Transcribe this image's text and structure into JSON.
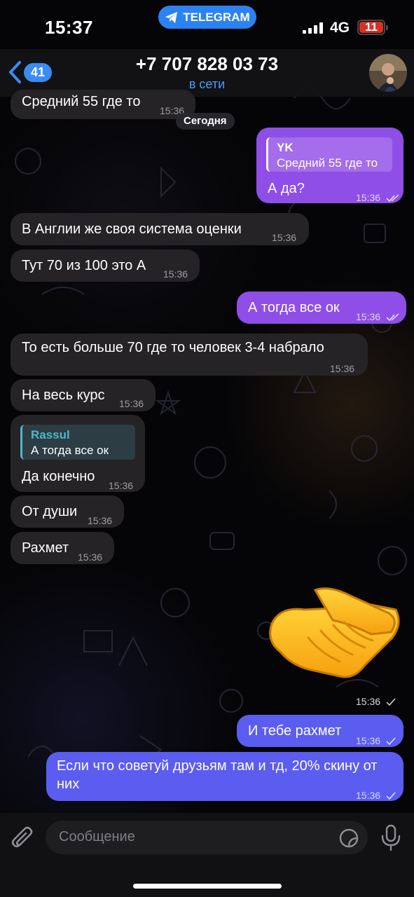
{
  "status_bar": {
    "time": "15:37",
    "app_pill": "TELEGRAM",
    "network": "4G",
    "battery": "11"
  },
  "header": {
    "back_count": "41",
    "title": "+7 707 828 03 73",
    "subtitle": "в сети"
  },
  "date_separator": "Сегодня",
  "messages": [
    {
      "dir": "in",
      "text": "Средний 55 где то",
      "time": "15:36"
    },
    {
      "dir": "out",
      "reply_name": "YK",
      "reply_text": "Средний 55 где то",
      "text": "А да?",
      "time": "15:36"
    },
    {
      "dir": "in",
      "text": "В Англии же своя система оценки",
      "time": "15:36"
    },
    {
      "dir": "in",
      "text": "Тут 70 из 100 это А",
      "time": "15:36"
    },
    {
      "dir": "out",
      "text": "А тогда все ок",
      "time": "15:36"
    },
    {
      "dir": "in",
      "text": "То есть больше 70 где то человек 3-4 набрало",
      "time": "15:36"
    },
    {
      "dir": "in",
      "text": "На весь курс",
      "time": "15:36"
    },
    {
      "dir": "in",
      "reply_name": "Rassul",
      "reply_text": "А тогда все ок",
      "text": "Да конечно",
      "time": "15:36"
    },
    {
      "dir": "in",
      "text": "От души",
      "time": "15:36"
    },
    {
      "dir": "in",
      "text": "Рахмет",
      "time": "15:36"
    },
    {
      "dir": "out",
      "sticker": "handshake-emoji",
      "time": "15:36"
    },
    {
      "dir": "out",
      "text": "И тебе рахмет",
      "time": "15:36"
    },
    {
      "dir": "out",
      "text": "Если что советуй друзьям там и тд, 20% скину от них",
      "time": "15:36"
    }
  ],
  "composer": {
    "placeholder": "Сообщение"
  },
  "colors": {
    "outgoing_purple": "#8f4ee7",
    "outgoing_blue": "#5b5cf0",
    "incoming": "#252326",
    "accent": "#3a8cf3",
    "reply_accent_in": "#4fb6c8"
  },
  "icons": [
    "telegram-icon",
    "back-chevron-icon",
    "paperclip-icon",
    "sticker-icon",
    "microphone-icon",
    "double-check-icon",
    "single-check-icon",
    "handshake-emoji"
  ]
}
